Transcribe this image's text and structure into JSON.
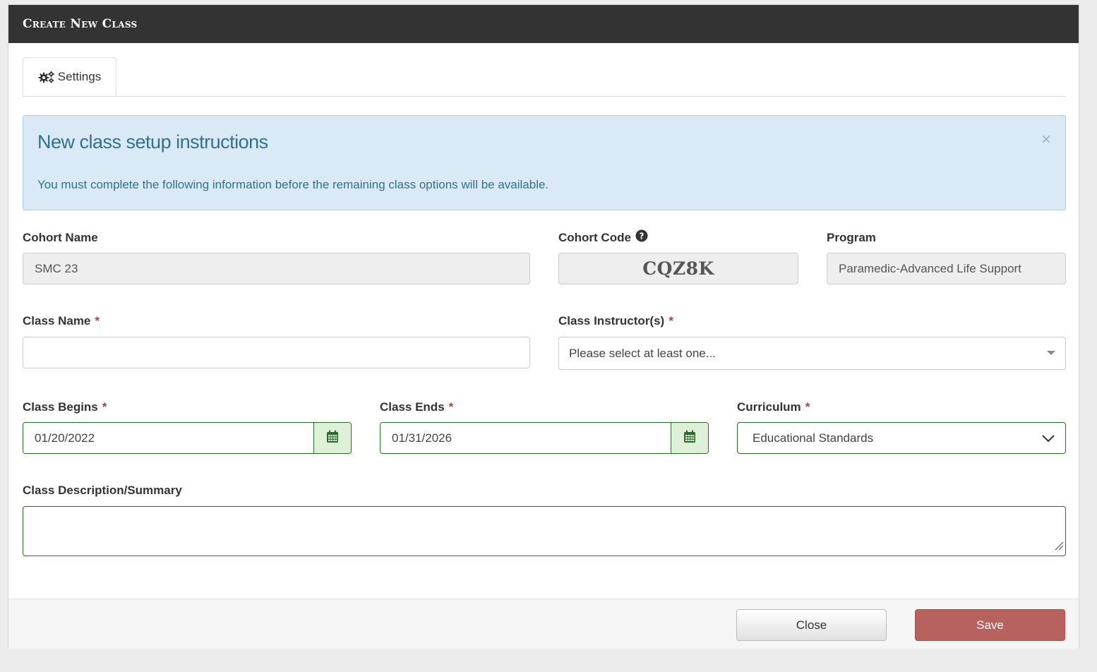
{
  "modal": {
    "title": "Create New Class"
  },
  "tabs": [
    {
      "label": "Settings",
      "icon": "gears-icon",
      "active": true
    }
  ],
  "alert": {
    "title": "New class setup instructions",
    "text": "You must complete the following information before the remaining class options will be available.",
    "close_glyph": "×"
  },
  "form": {
    "cohort_name": {
      "label": "Cohort Name",
      "value": "SMC 23"
    },
    "cohort_code": {
      "label": "Cohort Code",
      "value": "CQZ8K",
      "help_icon": "question-circle-icon"
    },
    "program": {
      "label": "Program",
      "value": "Paramedic-Advanced Life Support"
    },
    "class_name": {
      "label": "Class Name",
      "required_mark": "*",
      "value": ""
    },
    "class_instructors": {
      "label": "Class Instructor(s)",
      "required_mark": "*",
      "placeholder": "Please select at least one..."
    },
    "class_begins": {
      "label": "Class Begins",
      "required_mark": "*",
      "value": "01/20/2022",
      "icon": "calendar-icon"
    },
    "class_ends": {
      "label": "Class Ends",
      "required_mark": "*",
      "value": "01/31/2026",
      "icon": "calendar-icon"
    },
    "curriculum": {
      "label": "Curriculum",
      "required_mark": "*",
      "value": "Educational Standards"
    },
    "class_description": {
      "label": "Class Description/Summary",
      "value": ""
    }
  },
  "footer": {
    "close_label": "Close",
    "save_label": "Save"
  },
  "colors": {
    "header_bg": "#333333",
    "alert_bg": "#d9eaf6",
    "alert_text": "#31708f",
    "required": "#a94442",
    "valid_border": "#2d6a2d",
    "save_bg": "#b8625f"
  }
}
